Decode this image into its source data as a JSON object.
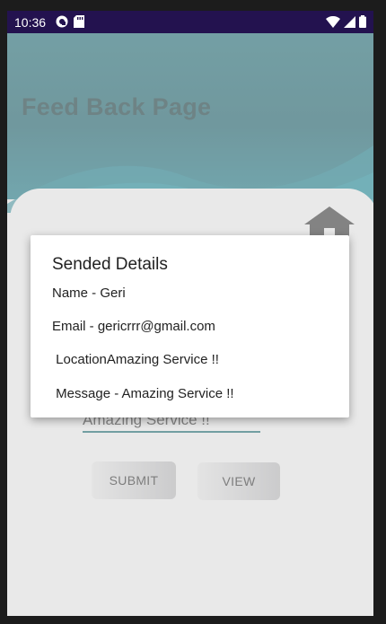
{
  "status_bar": {
    "time": "10:36",
    "icons_left": [
      "pocket-casts-icon",
      "sd-card-icon"
    ],
    "icons_right": [
      "wifi-icon",
      "signal-icon",
      "battery-icon"
    ]
  },
  "page": {
    "title": "Feed Back Page",
    "message_field_value": "Amazing Service !!",
    "buttons": {
      "submit": "SUBMIT",
      "view": "VIEW"
    },
    "colors": {
      "header": "#0a4e58",
      "accent_underline": "#0d5a60"
    }
  },
  "dialog": {
    "title": "Sended Details",
    "lines": [
      "Name - Geri",
      "Email - gericrrr@gmail.com",
      " LocationAmazing Service !!",
      " Message - Amazing Service !!"
    ]
  }
}
